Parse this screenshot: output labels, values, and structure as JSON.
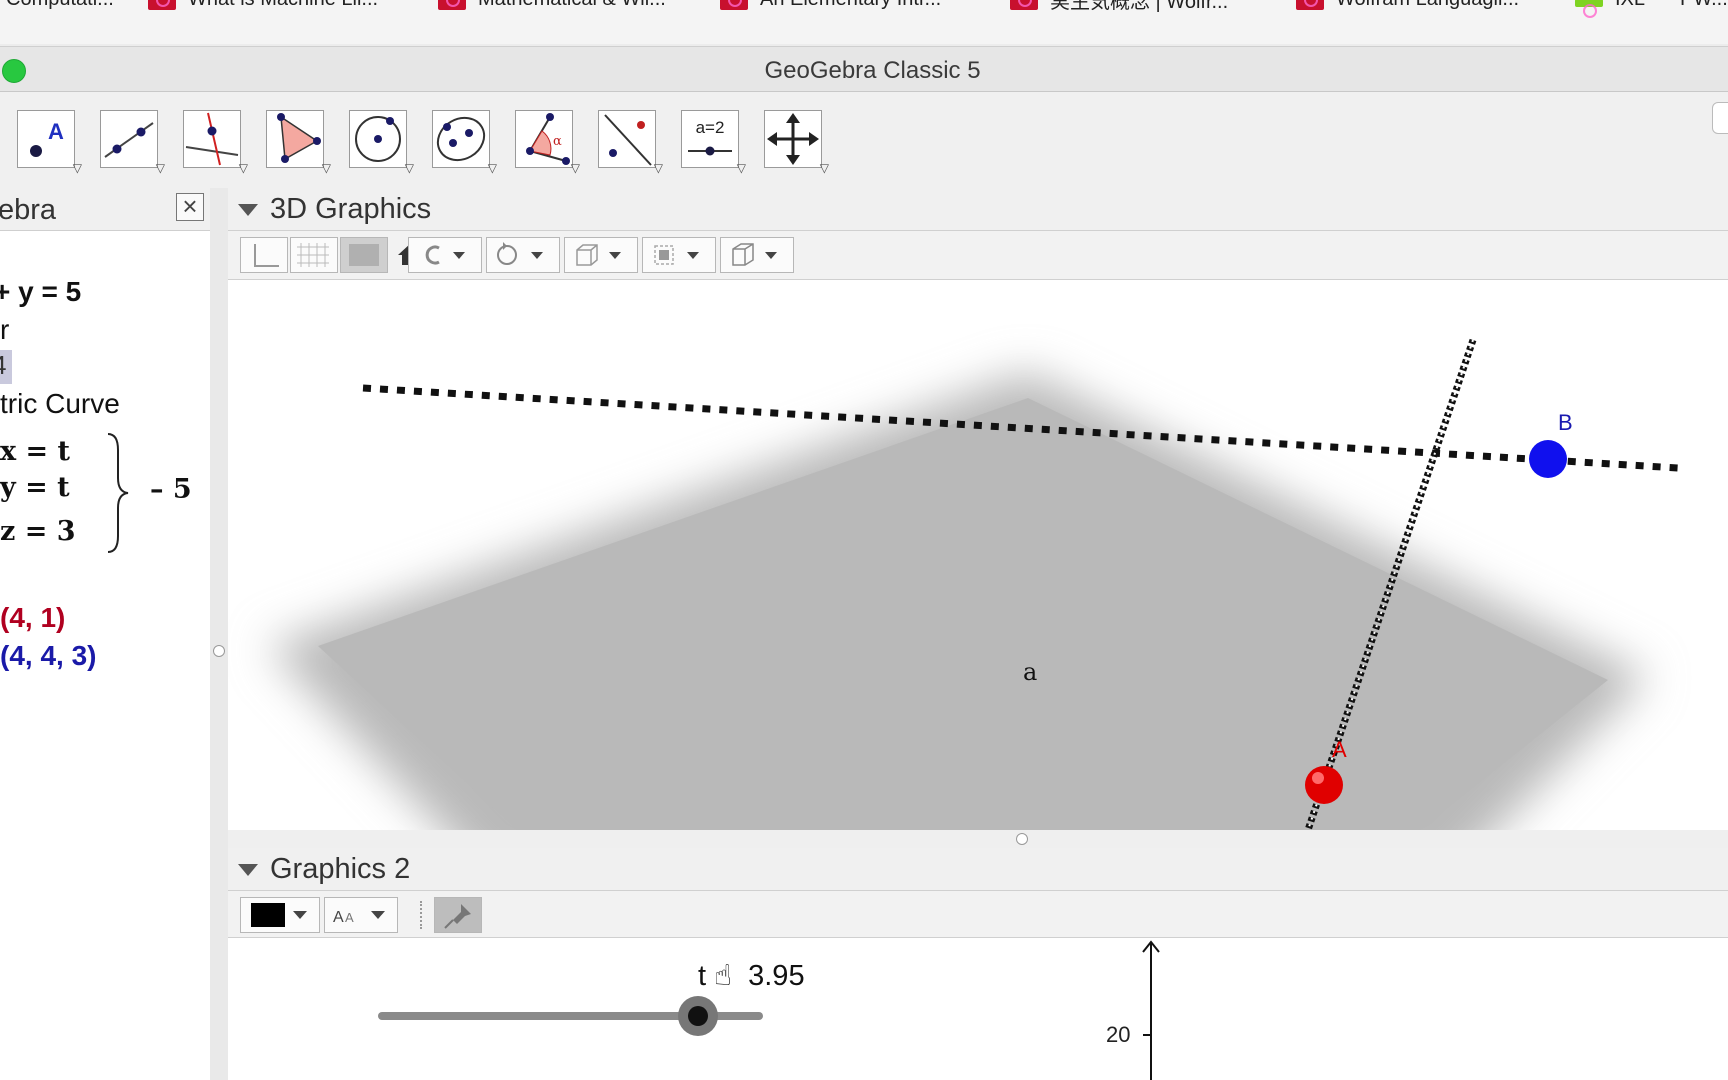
{
  "browser": {
    "bookmarks": [
      {
        "label": "Computati..."
      },
      {
        "label": "What is Machine Lii..."
      },
      {
        "label": "Mathematical & Wil..."
      },
      {
        "label": "An Elementary Intr..."
      },
      {
        "label": "実生気概念 | Wolfr..."
      },
      {
        "label": "Wolfram Languagii..."
      },
      {
        "label": "IXL"
      },
      {
        "label": "PW..."
      }
    ]
  },
  "window": {
    "title": "GeoGebra Classic 5"
  },
  "toolbar": {
    "tools": [
      {
        "name": "point-tool",
        "icon": "point-icon",
        "label": "A"
      },
      {
        "name": "line-tool",
        "icon": "line-icon"
      },
      {
        "name": "perpendicular-line-tool",
        "icon": "perpendicular-icon"
      },
      {
        "name": "polygon-tool",
        "icon": "polygon-icon"
      },
      {
        "name": "circle-tool",
        "icon": "circle-icon"
      },
      {
        "name": "conic-tool",
        "icon": "ellipse-icon"
      },
      {
        "name": "angle-tool",
        "icon": "angle-icon",
        "label": "α"
      },
      {
        "name": "reflect-tool",
        "icon": "reflect-icon"
      },
      {
        "name": "slider-tool",
        "icon": "slider-icon",
        "label": "a=2"
      },
      {
        "name": "move-graphics-tool",
        "icon": "move-arrows-icon"
      }
    ]
  },
  "algebra": {
    "title": "ebra",
    "items": {
      "eq": "+ y = 5",
      "line2": "r",
      "sel": "4",
      "curve": "tric Curve",
      "cx": "x = t",
      "cy": "y = t",
      "cz": "z = 3",
      "range": "– 5",
      "pA": "(4, 1)",
      "pB": "(4, 4, 3)"
    }
  },
  "graphics3d": {
    "title": "3D Graphics",
    "plane_label": "a",
    "point_a": "A",
    "point_b": "B",
    "colors": {
      "point_a": "#e00000",
      "point_b": "#1010ee",
      "plane": "#b9b9b9"
    }
  },
  "graphics2": {
    "title": "Graphics 2",
    "slider": {
      "name": "t",
      "value": "3.95",
      "fraction": 0.83
    },
    "axis_tick": "20"
  }
}
